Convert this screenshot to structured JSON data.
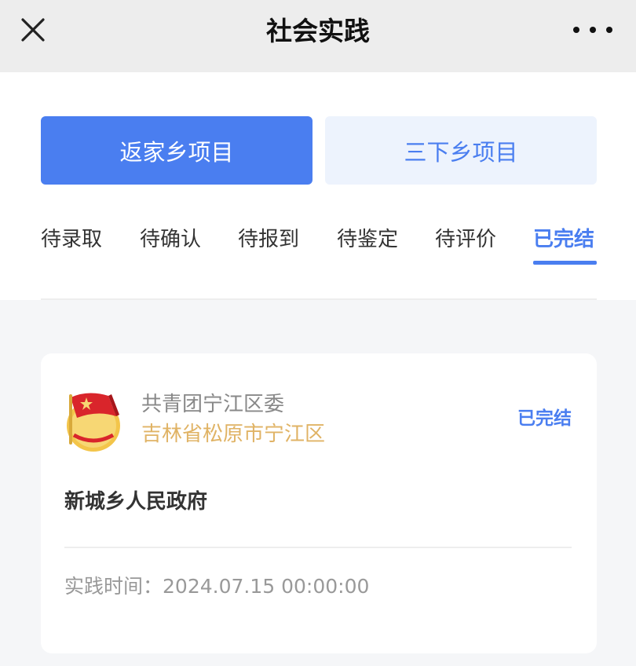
{
  "header": {
    "title": "社会实践",
    "close_icon": "close-icon",
    "more_icon": "more-horizontal-icon"
  },
  "segments": [
    {
      "label": "返家乡项目",
      "active": true
    },
    {
      "label": "三下乡项目",
      "active": false
    }
  ],
  "tabs": [
    {
      "label": "待录取",
      "active": false
    },
    {
      "label": "待确认",
      "active": false
    },
    {
      "label": "待报到",
      "active": false
    },
    {
      "label": "待鉴定",
      "active": false
    },
    {
      "label": "待评价",
      "active": false
    },
    {
      "label": "已完结",
      "active": true
    }
  ],
  "card": {
    "org_name": "共青团宁江区委",
    "location": "吉林省松原市宁江区",
    "status": "已完结",
    "project_name": "新城乡人民政府",
    "time_label": "实践时间：",
    "time_value": "2024.07.15 00:00:00",
    "logo_icon": "youth-league-emblem-icon"
  },
  "colors": {
    "accent": "#4a7ef0",
    "accent_light": "#edf3fd",
    "location": "#e0b365",
    "header_bg": "#ededed",
    "page_bg": "#f5f6f8"
  }
}
